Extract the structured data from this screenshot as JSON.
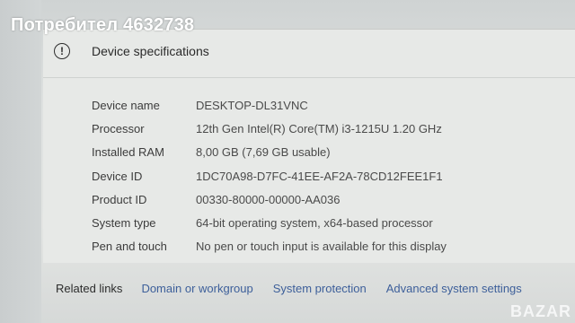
{
  "watermark": "Потребител 4632738",
  "section": {
    "title": "Device specifications",
    "icon": "info-icon"
  },
  "specs": [
    {
      "label": "Device name",
      "value": "DESKTOP-DL31VNC"
    },
    {
      "label": "Processor",
      "value": "12th Gen Intel(R) Core(TM) i3-1215U   1.20 GHz"
    },
    {
      "label": "Installed RAM",
      "value": "8,00 GB (7,69 GB usable)"
    },
    {
      "label": "Device ID",
      "value": "1DC70A98-D7FC-41EE-AF2A-78CD12FEE1F1"
    },
    {
      "label": "Product ID",
      "value": "00330-80000-00000-AA036"
    },
    {
      "label": "System type",
      "value": "64-bit operating system, x64-based processor"
    },
    {
      "label": "Pen and touch",
      "value": "No pen or touch input is available for this display"
    }
  ],
  "related": {
    "label": "Related links",
    "links": [
      "Domain or workgroup",
      "System protection",
      "Advanced system settings"
    ]
  },
  "corner_logo": "BAZAR"
}
